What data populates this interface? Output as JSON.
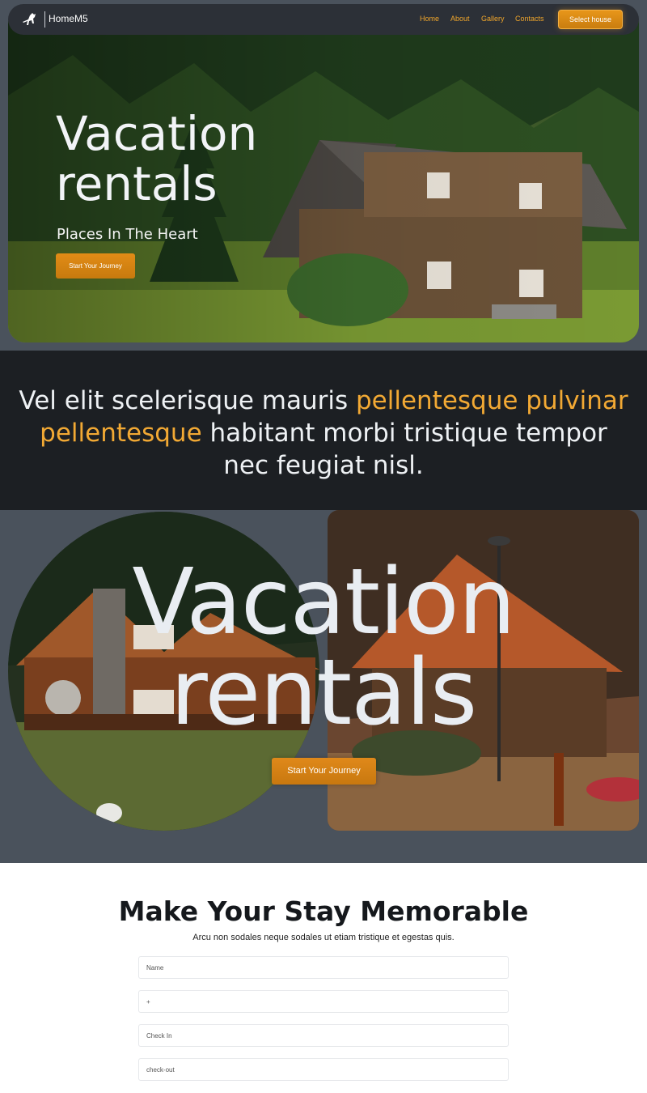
{
  "nav": {
    "brand": "HomeM5",
    "links": [
      "Home",
      "About",
      "Gallery",
      "Contacts"
    ],
    "cta": "Select house"
  },
  "hero": {
    "title_line1": "Vacation",
    "title_line2": "rentals",
    "subtitle": "Places In The Heart",
    "cta": "Start Your Journey"
  },
  "quote": {
    "part1": "Vel elit scelerisque mauris ",
    "highlight": "pellentesque pulvinar pellentesque",
    "part2": " habitant morbi tristique tempor nec feugiat nisl."
  },
  "gallery": {
    "title_line1": "Vacation",
    "title_line2": "rentals",
    "cta": "Start Your Journey"
  },
  "form": {
    "title": "Make Your Stay Memorable",
    "subtitle": "Arcu non sodales neque sodales ut etiam tristique et egestas quis.",
    "fields": [
      "Name",
      "+",
      "Check In",
      "check-out"
    ]
  },
  "colors": {
    "accent": "#f0a62b",
    "button": "#e28c16",
    "dark": "#1c1f23",
    "slate": "#4a525c",
    "nav": "#2c3037"
  },
  "icons": [
    "horse-logo-icon"
  ]
}
